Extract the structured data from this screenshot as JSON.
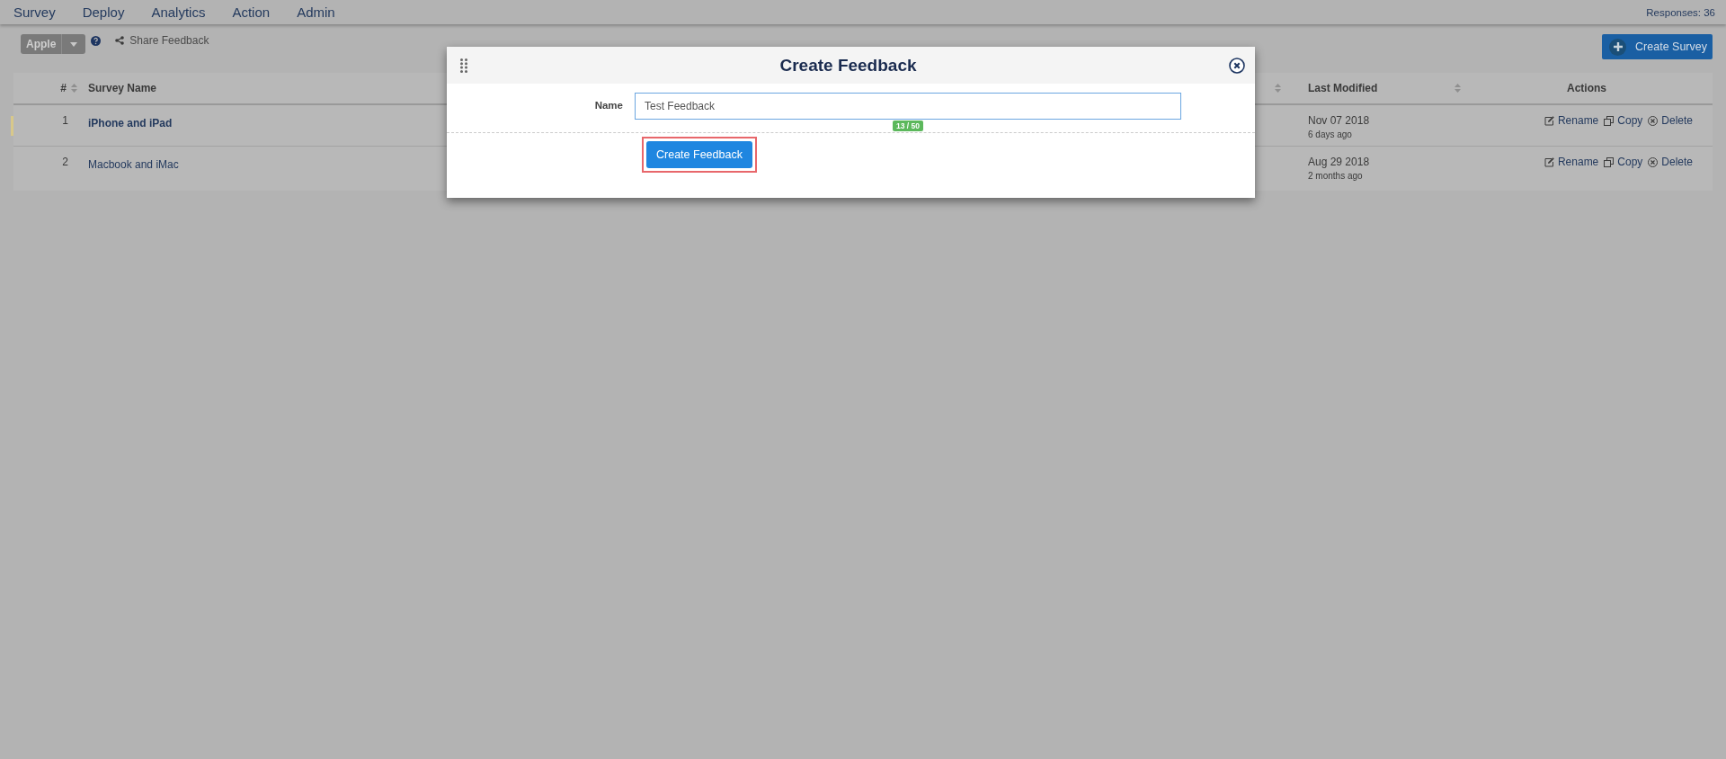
{
  "nav": {
    "items": [
      "Survey",
      "Deploy",
      "Analytics",
      "Action",
      "Admin"
    ],
    "responses": "Responses: 36"
  },
  "toolbar": {
    "account": "Apple",
    "share": "Share Feedback",
    "create": "Create Survey"
  },
  "table": {
    "columns": [
      "#",
      "Survey Name",
      "Last Modified",
      "Actions"
    ],
    "rows": [
      {
        "index": "1",
        "name": "iPhone and iPad",
        "date": "Nov 07 2018",
        "ago": "6 days ago",
        "selected": true,
        "actions": [
          "Rename",
          "Copy",
          "Delete"
        ]
      },
      {
        "index": "2",
        "name": "Macbook and iMac",
        "date": "Aug 29 2018",
        "ago": "2 months ago",
        "selected": false,
        "actions": [
          "Rename",
          "Copy",
          "Delete"
        ]
      }
    ]
  },
  "dialog": {
    "title": "Create Feedback",
    "field_label": "Name",
    "value": "Test Feedback",
    "counter": "13 / 50",
    "button": "Create Feedback"
  }
}
